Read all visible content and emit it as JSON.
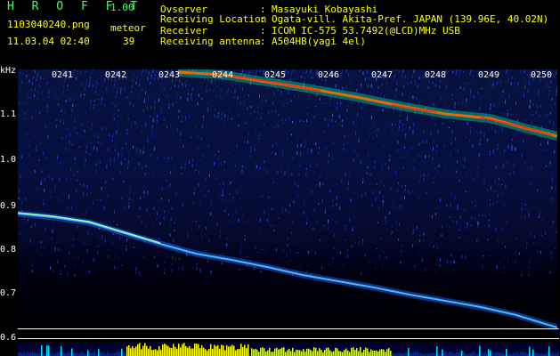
{
  "header": {
    "brand": "H R O F F T",
    "version": "1.00",
    "filename": "1103040240.png",
    "meteor_label": "meteor",
    "meteor_count": "39",
    "datetime": "11.03.04 02:40"
  },
  "info": [
    {
      "key": "Ovserver",
      "value": "Masayuki Kobayashi"
    },
    {
      "key": "Receiving Location",
      "value": "Ogata-vill. Akita-Pref. JAPAN (139.96E, 40.02N)"
    },
    {
      "key": "Receiver",
      "value": "ICOM IC-575 53.7492(@LCD)MHz USB"
    },
    {
      "key": "Receiving antenna",
      "value": "A504HB(yagi 4el)"
    }
  ],
  "axis": {
    "y_unit": "kHz",
    "y_ticks": [
      "1.1",
      "1.0",
      "0.9",
      "0.8",
      "0.7",
      "0.6"
    ],
    "x_ticks": [
      "0241",
      "0242",
      "0243",
      "0244",
      "0245",
      "0246",
      "0247",
      "0248",
      "0249",
      "0250"
    ]
  },
  "colors": {
    "header_text": "#ffff00",
    "brand": "#3cff6e",
    "axis_text": "#ffffff",
    "background": "#000000",
    "trace_upper": "#ff6a00",
    "trace_lower": "#4fb3ff"
  }
}
